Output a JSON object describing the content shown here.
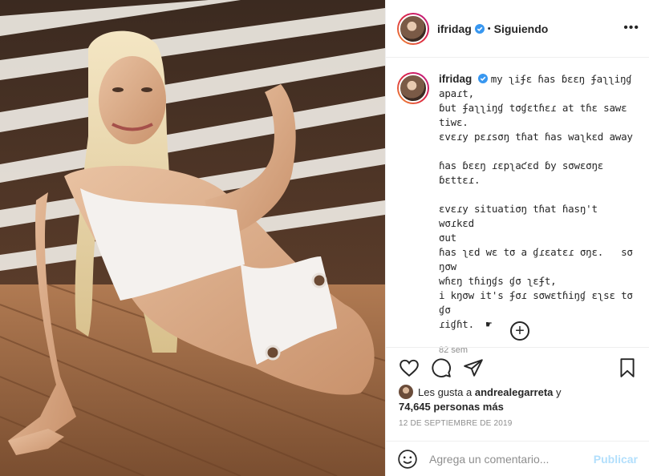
{
  "header": {
    "username": "ifridag",
    "separator": "•",
    "follow_status": "Siguiendo",
    "more": "•••"
  },
  "caption": {
    "username": "ifridag",
    "text": "my ʅiʄɛ ɦas ɓɛɛŋ ʄaʅʅiŋɠ\napaɾt,\nɓut ʄaʅʅiŋɠ tσɠɛtɦɛɾ at tɦɛ sawɛ\ntiwɛ.\nɛvɛɾy pɛɾsσŋ tɦat ɦas waʅkɛd away\n\nɦas ɓɛɛŋ ɾɛpʅaƈɛd ɓy sσwɛσŋɛ ɓɛttɛɾ.\n\nɛvɛɾy situatiσŋ tɦat ɦasŋ't wσɾkɛd\nσut\nɦas ʅɛd wɛ tσ a ɠɾɛatɛɾ σŋɛ.   sσ ŋσw\nwɦɛŋ tɦiŋɠs ɠσ ʅɛʄt,\ni kŋσw it's ʄσɾ sσwɛtɦiŋɠ ɛʅsɛ tσ ɠσ\nɾiɠɦt.  ☛",
    "time": "82 sem"
  },
  "likes": {
    "prefix": "Les gusta a",
    "user": "andrealegarreta",
    "conj": "y",
    "count": "74,645 personas más"
  },
  "date": "12 DE SEPTIEMBRE DE 2019",
  "comment": {
    "placeholder": "Agrega un comentario...",
    "publish": "Publicar"
  },
  "icons": {
    "verified": "verified-badge-icon",
    "like": "heart-icon",
    "comment": "comment-icon",
    "share": "paper-plane-icon",
    "save": "bookmark-icon",
    "emoji": "smiley-icon",
    "add": "plus-circle-icon"
  },
  "colors": {
    "verified": "#3897f0",
    "publish": "#b2dffc",
    "muted": "#8e8e8e",
    "text": "#262626"
  }
}
